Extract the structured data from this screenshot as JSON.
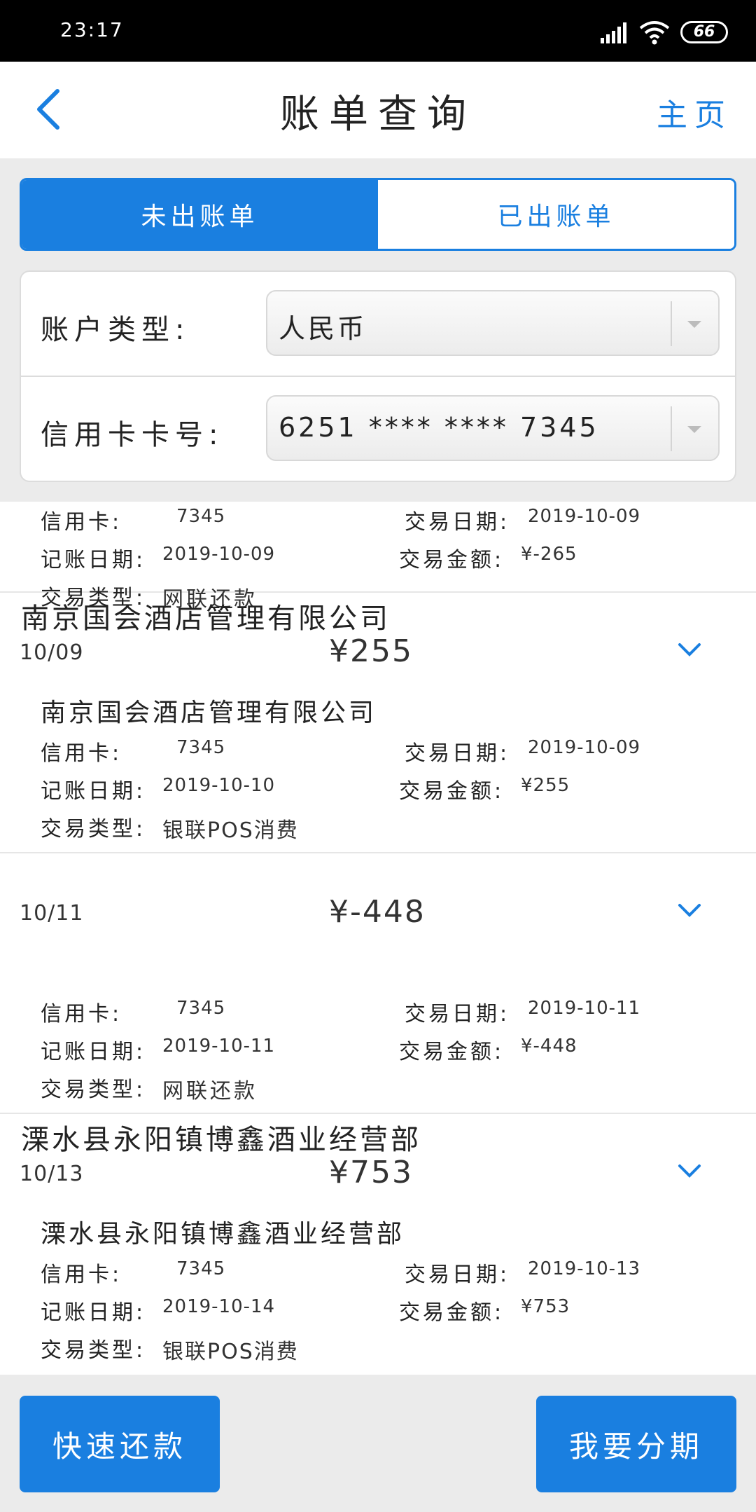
{
  "status_bar": {
    "time": "23:17",
    "battery": "66"
  },
  "header": {
    "title": "账单查询",
    "home_label": "主页"
  },
  "tabs": [
    {
      "label": "未出账单",
      "active": true
    },
    {
      "label": "已出账单",
      "active": false
    }
  ],
  "form": {
    "account_type_label": "账户类型:",
    "account_type_value": "人民币",
    "card_number_label": "信用卡卡号:",
    "card_number_value": "6251 **** **** 7345"
  },
  "detail_labels": {
    "card": "信用卡:",
    "trade_date": "交易日期:",
    "post_date": "记账日期:",
    "amount": "交易金额:",
    "trade_type": "交易类型:"
  },
  "transactions": [
    {
      "merchant": "",
      "date": "",
      "amount": "",
      "card": "7345",
      "trade_date": "2019-10-09",
      "post_date": "2019-10-09",
      "amount_detail": "¥-265",
      "trade_type": "网联还款"
    },
    {
      "merchant": "南京国会酒店管理有限公司",
      "date": "10/09",
      "amount": "¥255",
      "card": "7345",
      "trade_date": "2019-10-09",
      "post_date": "2019-10-10",
      "amount_detail": "¥255",
      "trade_type": "银联POS消费"
    },
    {
      "merchant": "",
      "date": "10/11",
      "amount": "¥-448",
      "card": "7345",
      "trade_date": "2019-10-11",
      "post_date": "2019-10-11",
      "amount_detail": "¥-448",
      "trade_type": "网联还款"
    },
    {
      "merchant": "溧水县永阳镇博鑫酒业经营部",
      "date": "10/13",
      "amount": "¥753",
      "card": "7345",
      "trade_date": "2019-10-13",
      "post_date": "2019-10-14",
      "amount_detail": "¥753",
      "trade_type": "银联POS消费"
    }
  ],
  "buttons": {
    "quick_repay": "快速还款",
    "installment": "我要分期"
  },
  "colors": {
    "accent": "#1a7fe0",
    "background": "#ebebeb"
  }
}
